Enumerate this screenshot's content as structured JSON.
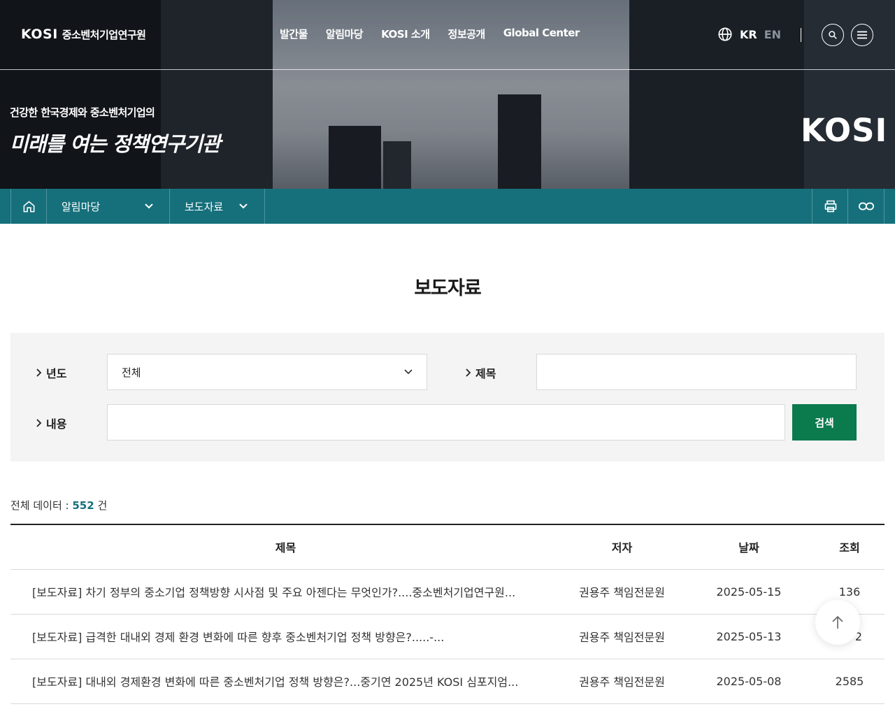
{
  "header": {
    "logo_mark": "KOSI",
    "logo_org": "중소벤처기업연구원",
    "nav": [
      "발간물",
      "알림마당",
      "KOSI 소개",
      "정보공개",
      "Global Center"
    ],
    "lang_kr": "KR",
    "lang_en": "EN"
  },
  "hero": {
    "slogan_small": "건강한 한국경제와 중소벤처기업의",
    "slogan_big": "미래를 여는 정책연구기관",
    "brand": "KOSI"
  },
  "breadcrumb": {
    "level1": "알림마당",
    "level2": "보도자료"
  },
  "page": {
    "title": "보도자료"
  },
  "search": {
    "year_label": "년도",
    "year_value": "전체",
    "title_label": "제목",
    "title_value": "",
    "content_label": "내용",
    "content_value": "",
    "button": "검색"
  },
  "summary": {
    "prefix": "전체 데이터 :",
    "count": "552",
    "suffix": "건"
  },
  "table": {
    "headers": [
      "제목",
      "저자",
      "날짜",
      "조회"
    ],
    "rows": [
      {
        "title": "[보도자료] 차기 정부의 중소기업 정책방향 시사점 및 주요 아젠다는 무엇인가?....중소벤처기업연구원...",
        "author": "권용주 책임전문원",
        "date": "2025-05-15",
        "views": "136"
      },
      {
        "title": "[보도자료] 급격한 대내외 경제 환경 변화에 따른 향후 중소벤처기업 정책 방향은?.....-...",
        "author": "권용주 책임전문원",
        "date": "2025-05-13",
        "views": "2"
      },
      {
        "title": "[보도자료] 대내외 경제환경 변화에 따른 중소벤처기업 정책 방향은?...중기연 2025년 KOSI 심포지엄...",
        "author": "권용주 책임전문원",
        "date": "2025-05-08",
        "views": "2585"
      }
    ]
  }
}
